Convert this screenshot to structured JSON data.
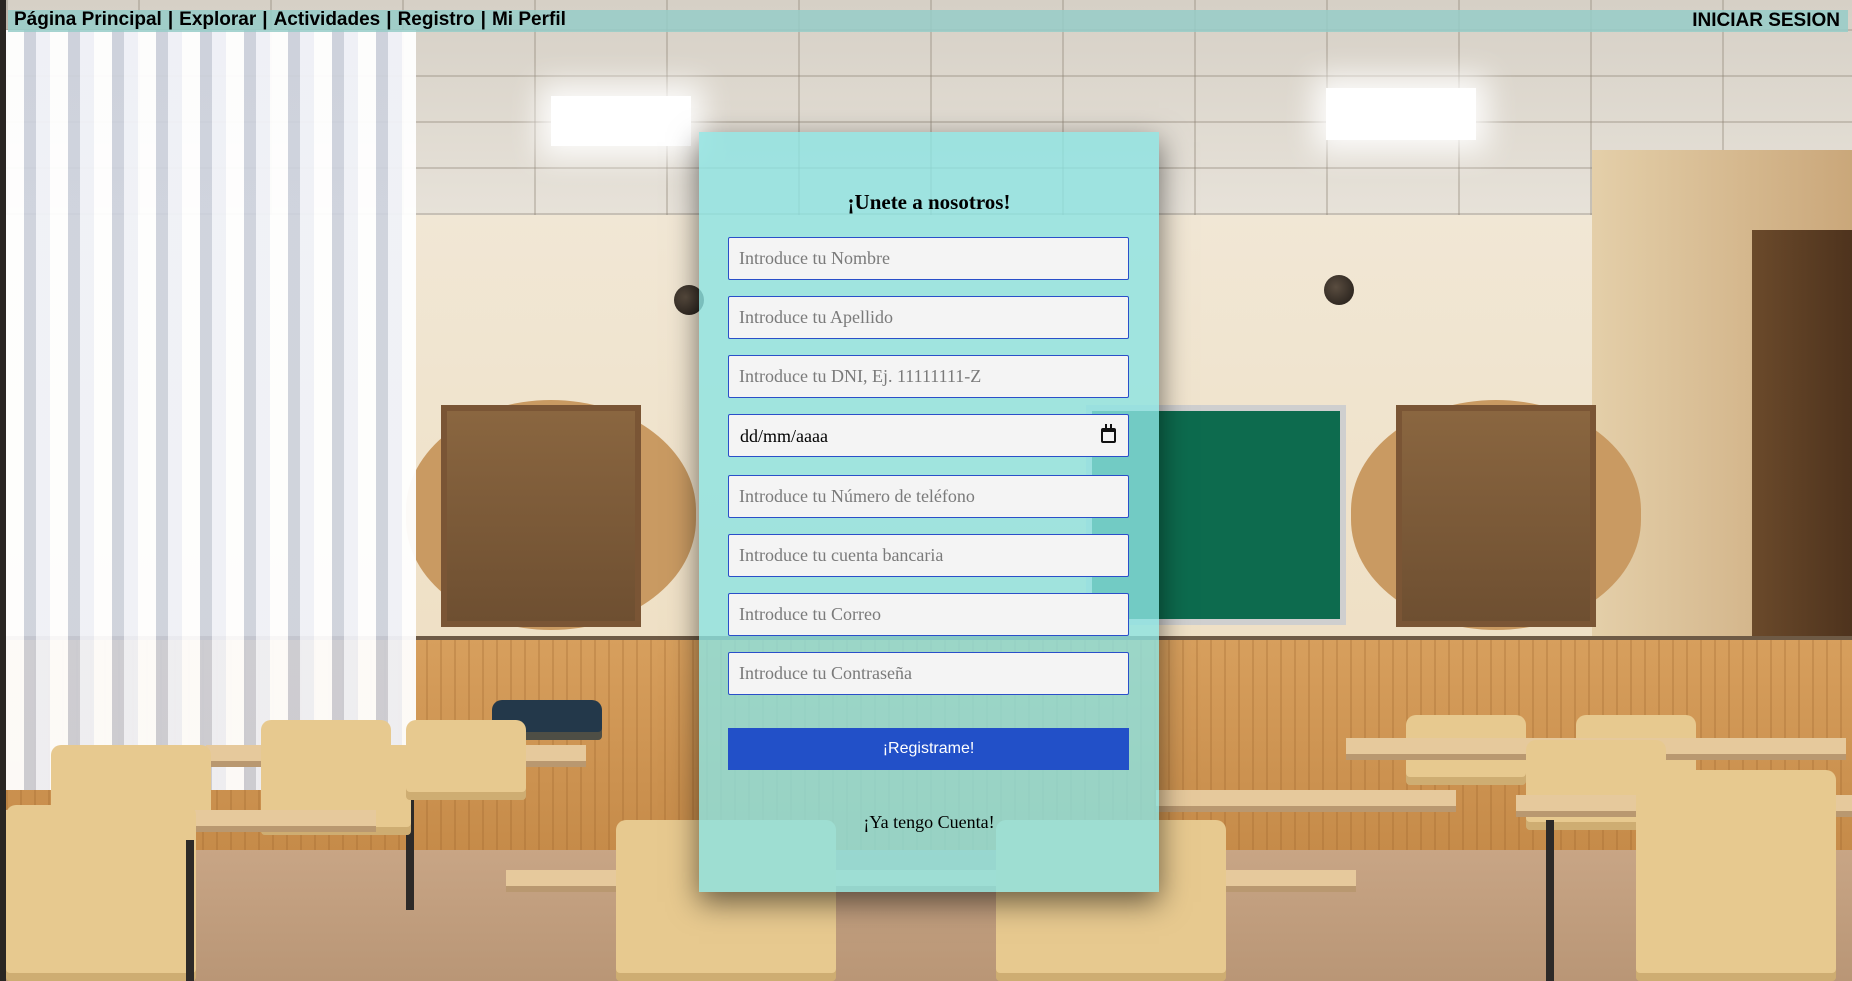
{
  "nav": {
    "links": [
      "Página Principal",
      "Explorar",
      "Actividades",
      "Registro",
      "Mi Perfil"
    ],
    "separator": "|",
    "login": "INICIAR SESION"
  },
  "form": {
    "title": "¡Unete a nosotros!",
    "fields": {
      "nombre_placeholder": "Introduce tu Nombre",
      "apellido_placeholder": "Introduce tu Apellido",
      "dni_placeholder": "Introduce tu DNI, Ej. 11111111-Z",
      "fecha_value": "dd/mm/aaaa",
      "telefono_placeholder": "Introduce tu Número de teléfono",
      "cuenta_placeholder": "Introduce tu cuenta bancaria",
      "correo_placeholder": "Introduce tu Correo",
      "password_placeholder": "Introduce tu Contraseña"
    },
    "submit_label": "¡Registrame!",
    "have_account_label": "¡Ya tengo Cuenta!"
  },
  "colors": {
    "card_bg": "#8ce4e2",
    "field_border": "#2a4fc9",
    "button_bg": "#2250c8",
    "topbar_bg": "#96cdc8"
  },
  "icons": {
    "date_picker": "calendar-icon"
  }
}
